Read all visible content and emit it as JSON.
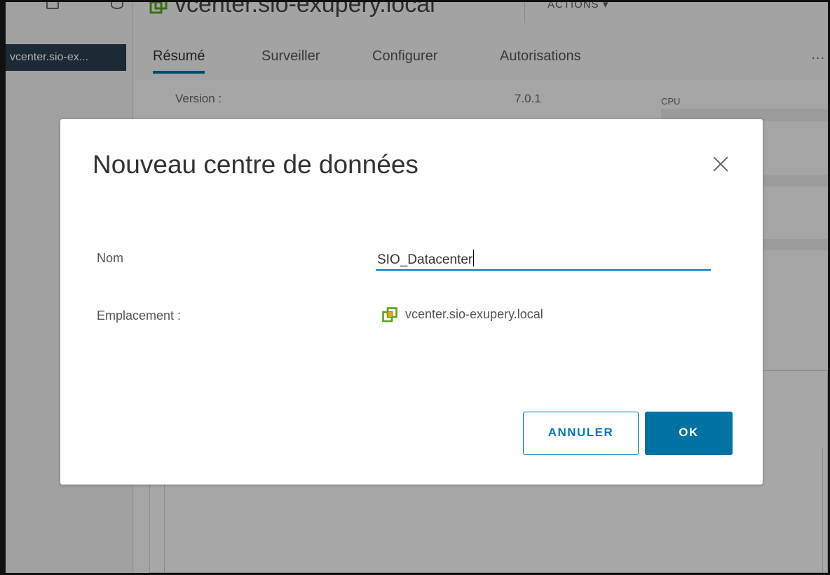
{
  "app": {
    "selected_tree_item": "vcenter.sio-ex...",
    "object_title": "vcenter.sio-exupery.local",
    "actions_label": "ACTIONS ▾",
    "tabs": [
      {
        "label": "Résumé",
        "active": true
      },
      {
        "label": "Surveiller",
        "active": false
      },
      {
        "label": "Configurer",
        "active": false
      },
      {
        "label": "Autorisations",
        "active": false
      }
    ],
    "more_label": "...",
    "summary": {
      "version_label": "Version :",
      "version_value": "7.0.1",
      "cpu_label": "CPU"
    },
    "colors": {
      "accent": "#0072a3",
      "tree_selected_bg": "#2c3e50"
    }
  },
  "dialog": {
    "title": "Nouveau centre de données",
    "close_icon": "close-icon",
    "name_label": "Nom",
    "name_value": "SIO_Datacenter",
    "location_label": "Emplacement :",
    "location_icon": "vcenter-icon",
    "location_value": "vcenter.sio-exupery.local",
    "cancel_label": "ANNULER",
    "ok_label": "OK"
  }
}
